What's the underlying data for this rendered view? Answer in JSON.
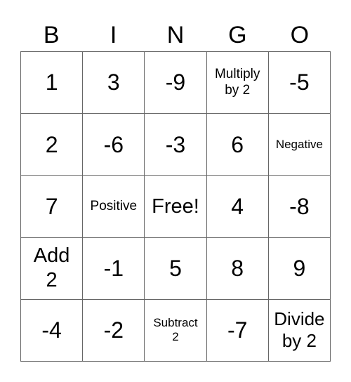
{
  "header": [
    "B",
    "I",
    "N",
    "G",
    "O"
  ],
  "cells": [
    [
      "1",
      "3",
      "-9",
      "Multiply by 2",
      "-5"
    ],
    [
      "2",
      "-6",
      "-3",
      "6",
      "Negative"
    ],
    [
      "7",
      "Positive",
      "Free!",
      "4",
      "-8"
    ],
    [
      "Add 2",
      "-1",
      "5",
      "8",
      "9"
    ],
    [
      "-4",
      "-2",
      "Subtract 2",
      "-7",
      "Divide by 2"
    ]
  ]
}
